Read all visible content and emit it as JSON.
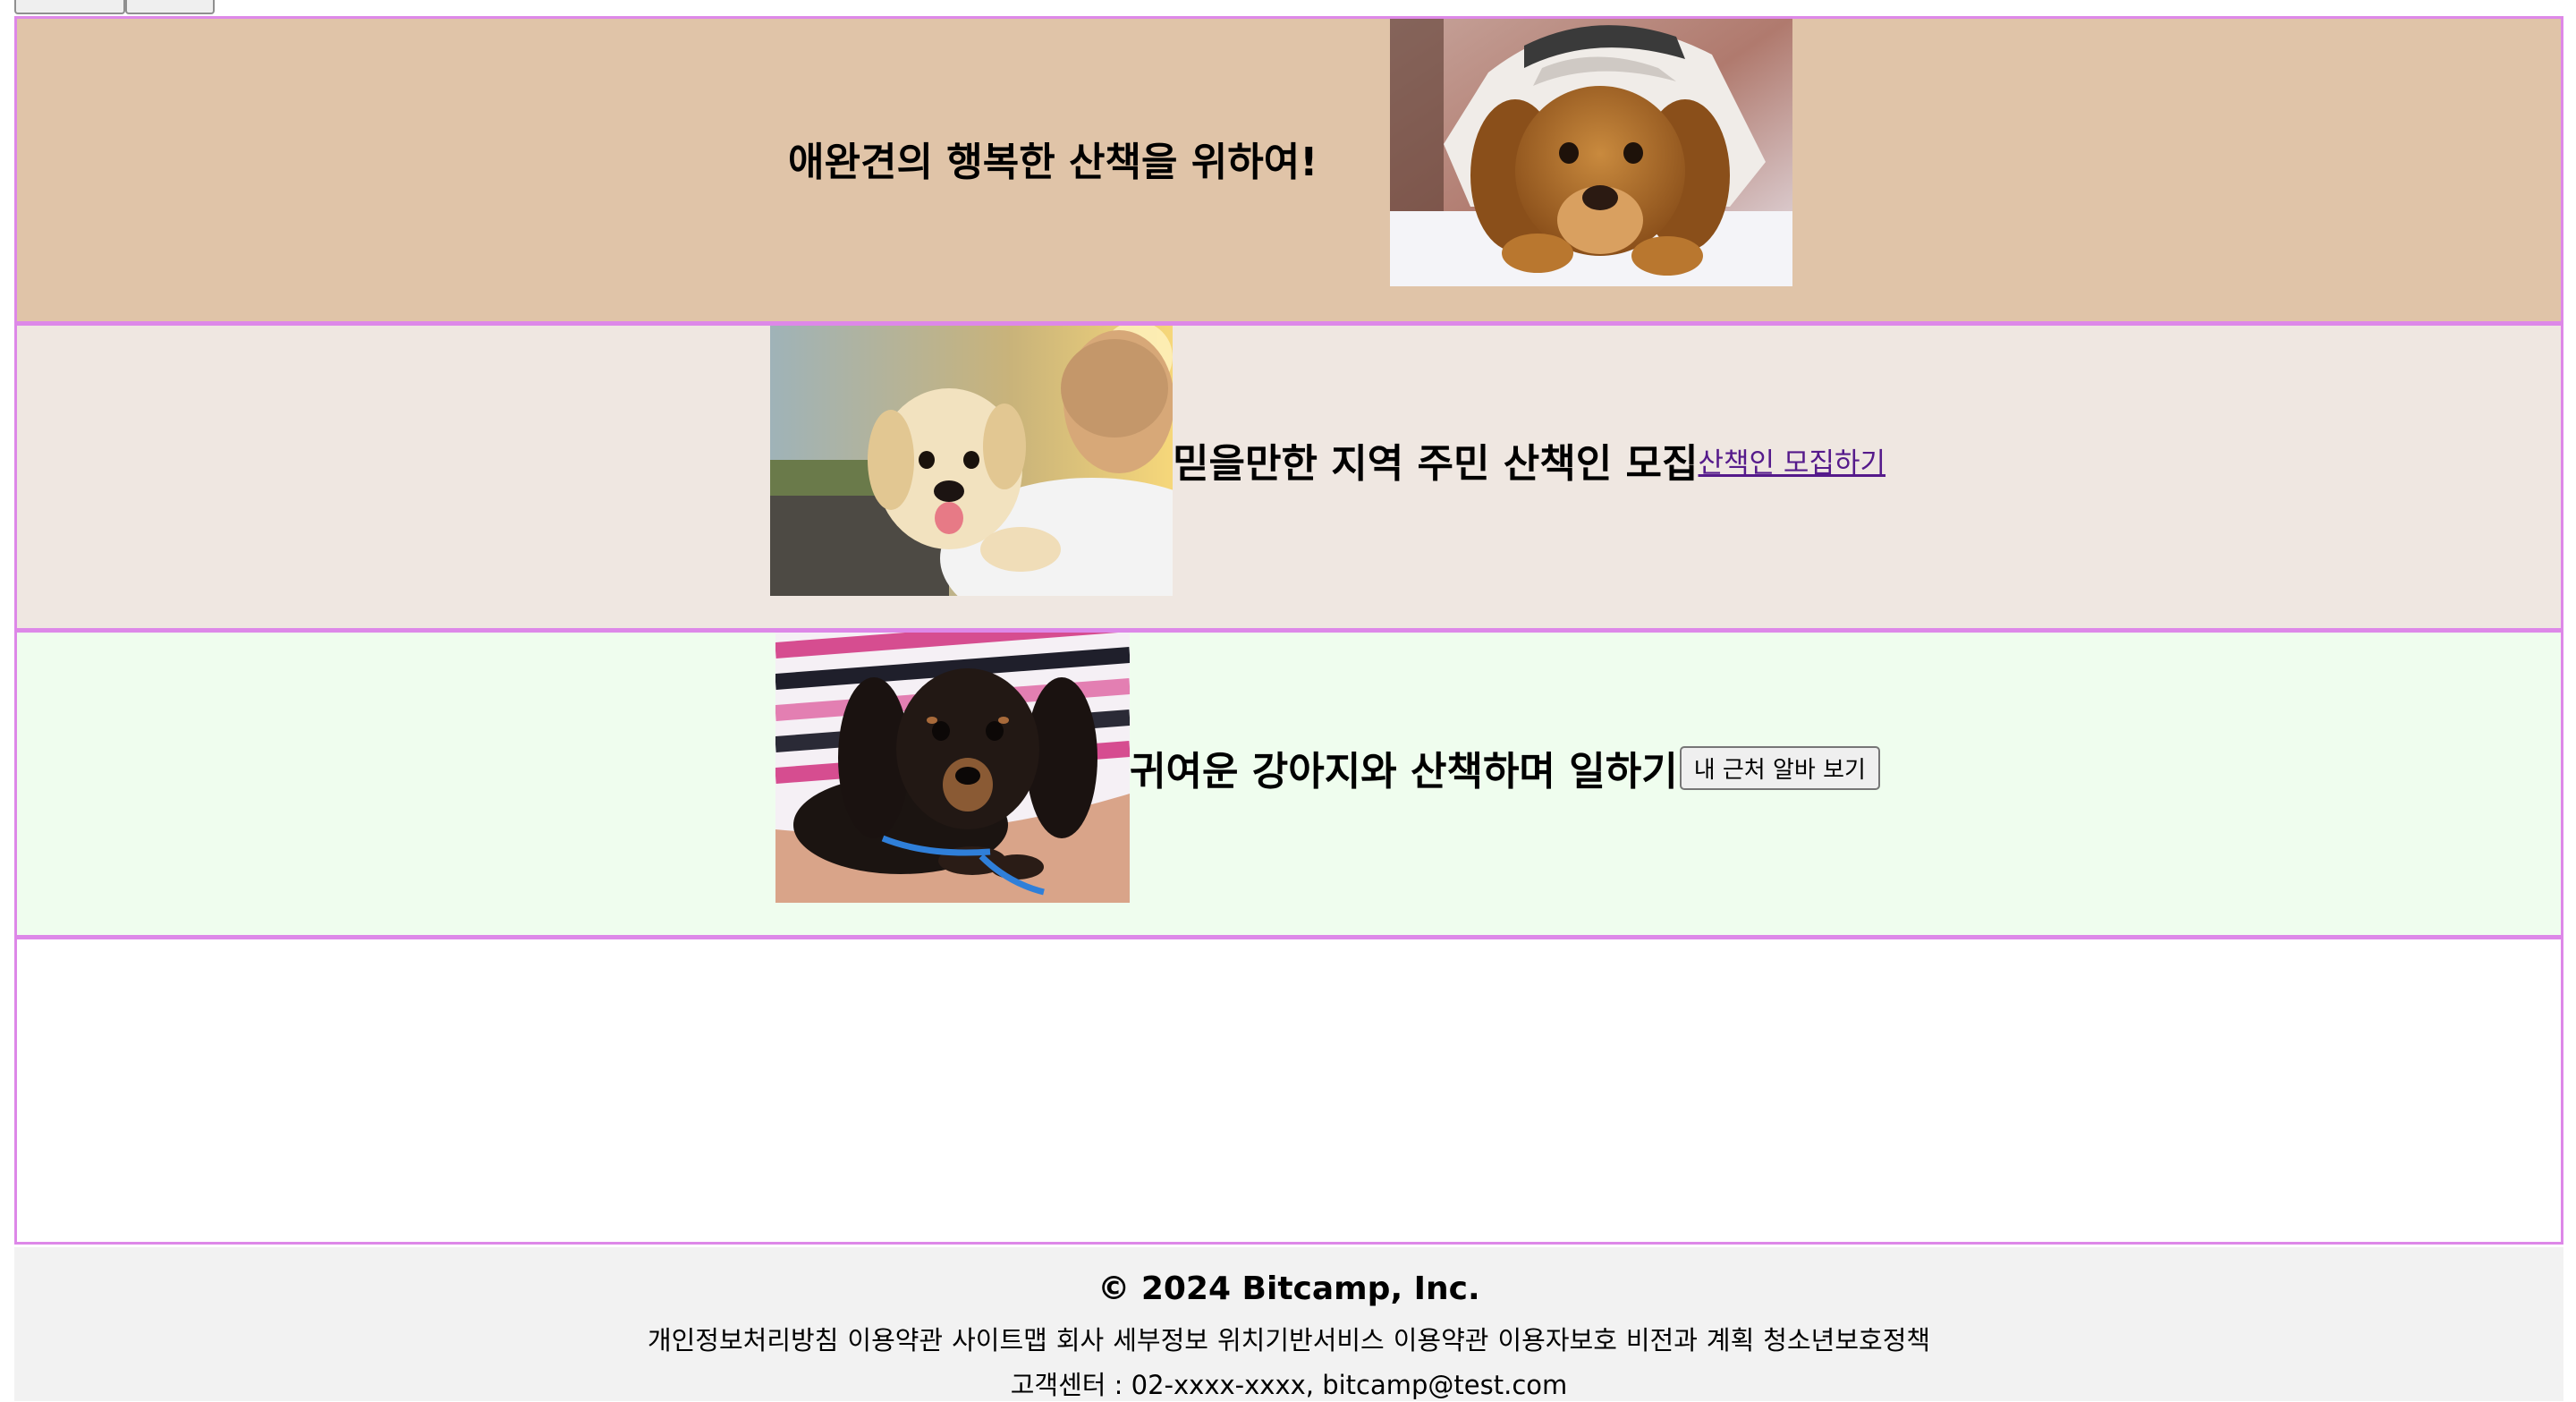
{
  "top_buttons": [
    "",
    ""
  ],
  "hero": {
    "title": "애완견의 행복한 산책을 위하여!",
    "image": "cocker-spaniel-under-blanket"
  },
  "recruit": {
    "title": "믿을만한 지역 주민 산책인 모집",
    "link_label": "산책인 모집하기",
    "image": "person-hugging-labrador-puppy"
  },
  "job": {
    "title": "귀여운 강아지와 산책하며 일하기",
    "button_label": "내 근처 알바 보기",
    "image": "dachshund-puppy-in-arms"
  },
  "footer": {
    "copyright": "© 2024 Bitcamp, Inc.",
    "links": [
      "개인정보처리방침",
      "이용약관",
      "사이트맵",
      "회사",
      "세부정보",
      "위치기반서비스",
      "이용약관",
      "이용자보호",
      "비전과",
      "계획",
      "청소년보호정책"
    ],
    "contact": "고객센터 : 02-xxxx-xxxx, bitcamp@test.com"
  },
  "colors": {
    "hero_bg": "#e0c4a8",
    "recruit_bg": "#efe7e1",
    "job_bg": "#effdee",
    "section_border": "#dd88e8",
    "footer_bg": "#f2f2f2",
    "link": "#551a8b"
  }
}
